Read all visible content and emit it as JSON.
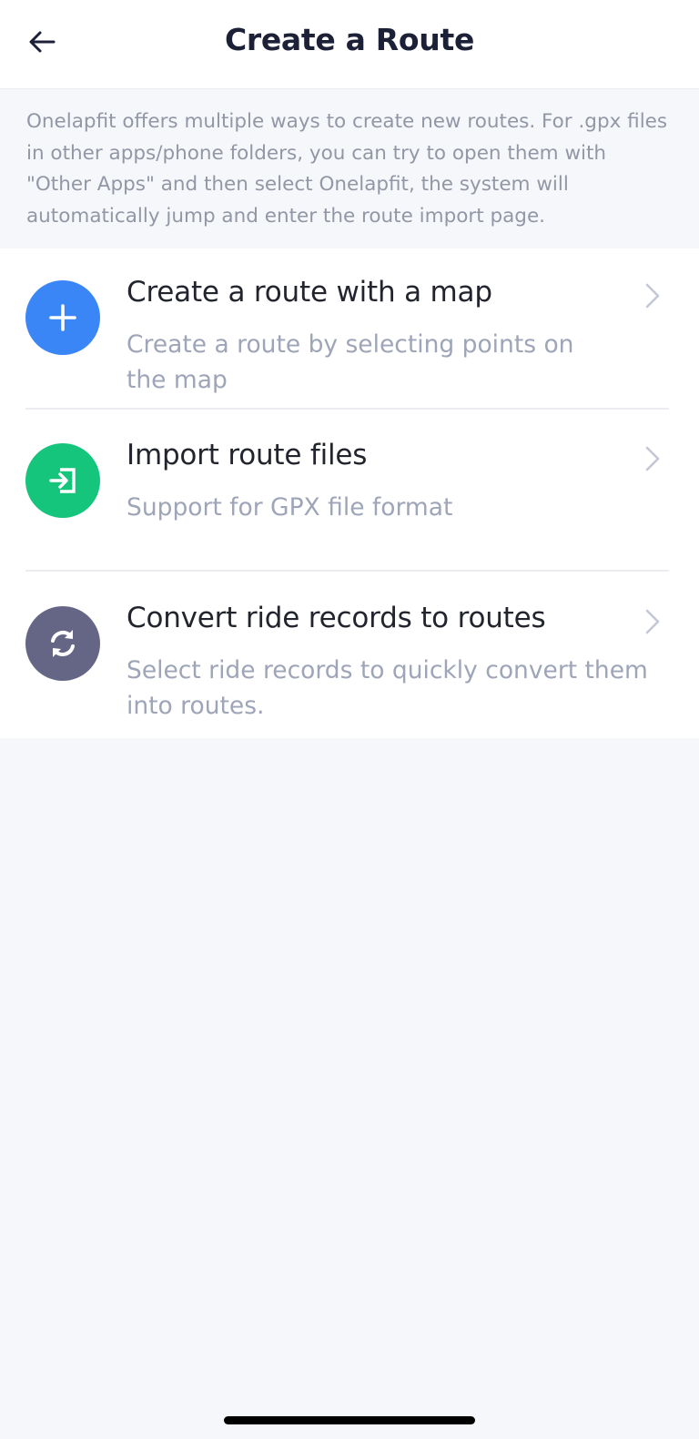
{
  "header": {
    "title": "Create a Route"
  },
  "intro": {
    "text": "Onelapfit offers multiple ways to create new routes. For .gpx files in other apps/phone folders, you can try to open them with \"Other Apps\" and then select Onelapfit, the system will automatically jump and enter the route import page."
  },
  "options": [
    {
      "title": "Create a route with a map",
      "description": "Create a route by selecting points on the map",
      "icon": "plus-icon",
      "color": "#3b86f7"
    },
    {
      "title": "Import route files",
      "description": "Support for GPX file format",
      "icon": "import-icon",
      "color": "#16c57c"
    },
    {
      "title": "Convert ride records to routes",
      "description": "Select ride records to quickly convert them into routes.",
      "icon": "convert-icon",
      "color": "#656685"
    }
  ],
  "colors": {
    "background": "#f6f7fb",
    "card": "#ffffff",
    "title_text": "#1c2137",
    "muted_text": "#9ea5b8",
    "chevron": "#c3c7d6"
  }
}
